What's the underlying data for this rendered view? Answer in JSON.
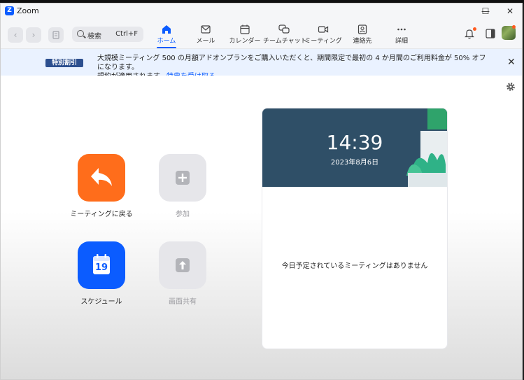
{
  "window": {
    "title": "Zoom",
    "logo_letter": "Z"
  },
  "window_controls": {
    "minimize": "—",
    "maximize": "☐",
    "close": "✕"
  },
  "search": {
    "label": "検索",
    "shortcut": "Ctrl+F"
  },
  "tabs": [
    {
      "label": "ホーム",
      "icon": "home-icon",
      "active": true
    },
    {
      "label": "メール",
      "icon": "mail-icon"
    },
    {
      "label": "カレンダー",
      "icon": "calendar-icon"
    },
    {
      "label": "チームチャット",
      "icon": "chat-icon"
    },
    {
      "label": "ミーティング",
      "icon": "video-icon"
    },
    {
      "label": "連絡先",
      "icon": "contacts-icon"
    },
    {
      "label": "詳細",
      "icon": "more-icon"
    }
  ],
  "banner": {
    "badge": "特別割引",
    "text": "大規模ミーティング 500 の月額アドオンプランをご購入いただくと、期間限定で最初の 4 か月間のご利用料金が 50% オフになります。",
    "text2": "規約が適用されます。",
    "link": "特典を受け取る",
    "close": "✕"
  },
  "actions": [
    {
      "label": "ミーティングに戻る",
      "icon": "return-arrow-icon",
      "color": "#ff6d1b",
      "enabled": true
    },
    {
      "label": "参加",
      "icon": "plus-icon",
      "color": "#e6e6ea",
      "enabled": false
    },
    {
      "label": "スケジュール",
      "icon": "calendar-19-icon",
      "calendar_day": "19",
      "color": "#0b5cff",
      "enabled": true
    },
    {
      "label": "画面共有",
      "icon": "share-up-arrow-icon",
      "color": "#e6e6ea",
      "enabled": false
    }
  ],
  "card": {
    "time": "14:39",
    "date": "2023年8月6日",
    "empty_message": "今日予定されているミーティングはありません"
  },
  "colors": {
    "accent": "#0b5cff",
    "banner_bg": "#eaf2ff",
    "badge_bg": "#2c4f8f",
    "card_header": "#2f4f67",
    "orange": "#ff6d1b",
    "notification": "#ff5a1f"
  }
}
